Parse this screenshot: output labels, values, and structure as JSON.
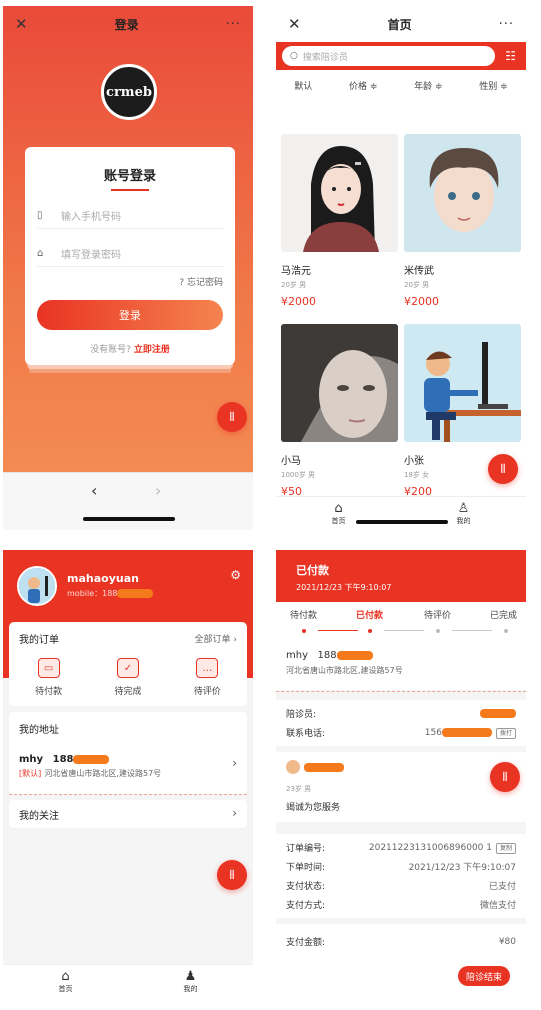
{
  "colors": {
    "accent": "#e93323",
    "mask": "#f57a1c"
  },
  "login": {
    "nav_title": "登录",
    "close_icon": "✕",
    "more_icon": "···",
    "logo_text": "crmeb",
    "card_title": "账号登录",
    "phone_placeholder": "输入手机号码",
    "password_placeholder": "填写登录密码",
    "forgot": "忘记密码",
    "login_button": "登录",
    "no_account": "没有账号?",
    "register_link": "立即注册"
  },
  "list": {
    "nav_title": "首页",
    "search_placeholder": "搜索陪诊员",
    "sorts": [
      "默认",
      "价格 ≑",
      "年龄 ≑",
      "性别 ≑"
    ],
    "items": [
      {
        "name": "马浩元",
        "meta": "20岁 男",
        "price": "¥2000"
      },
      {
        "name": "米传武",
        "meta": "20岁 男",
        "price": "¥2000"
      },
      {
        "name": "小马",
        "meta": "1000岁 男",
        "price": "¥50"
      },
      {
        "name": "小张",
        "meta": "18岁 女",
        "price": "¥200"
      }
    ],
    "tabs": [
      {
        "label": "首页"
      },
      {
        "label": "我的"
      }
    ]
  },
  "me": {
    "username": "mahaoyuan",
    "mobile_prefix": "mobile：188",
    "orders_title": "我的订单",
    "all_orders": "全部订单 ›",
    "order_icons": [
      {
        "label": "待付款"
      },
      {
        "label": "待完成"
      },
      {
        "label": "待评价"
      }
    ],
    "address_title": "我的地址",
    "addr_name": "mhy",
    "addr_phone": "188",
    "addr_default": "[默认]",
    "addr_line": "河北省唐山市路北区,建设路57号",
    "follow_title": "我的关注",
    "tabs": [
      {
        "label": "首页"
      },
      {
        "label": "我的"
      }
    ]
  },
  "order": {
    "status": "已付款",
    "time": "2021/12/23 下午9:10:07",
    "steps": [
      "待付款",
      "已付款",
      "待评价",
      "已完成"
    ],
    "name": "mhy",
    "phone": "188",
    "address": "河北省唐山市路北区,建设路57号",
    "escort_label": "陪诊员:",
    "tel_label": "联系电话:",
    "tel_value": "156",
    "call_btn": "拨打",
    "escort_age": "23岁 男",
    "escort_slogan": "竭诚为您服务",
    "info": [
      {
        "k": "订单编号:",
        "v": "20211223131006896000 1"
      },
      {
        "k": "下单时间:",
        "v": "2021/12/23 下午9:10:07"
      },
      {
        "k": "支付状态:",
        "v": "已支付"
      },
      {
        "k": "支付方式:",
        "v": "微信支付"
      }
    ],
    "copy_btn": "复制",
    "amount_label": "支付金额:",
    "amount_value": "¥80",
    "end_button": "陪诊结束"
  }
}
